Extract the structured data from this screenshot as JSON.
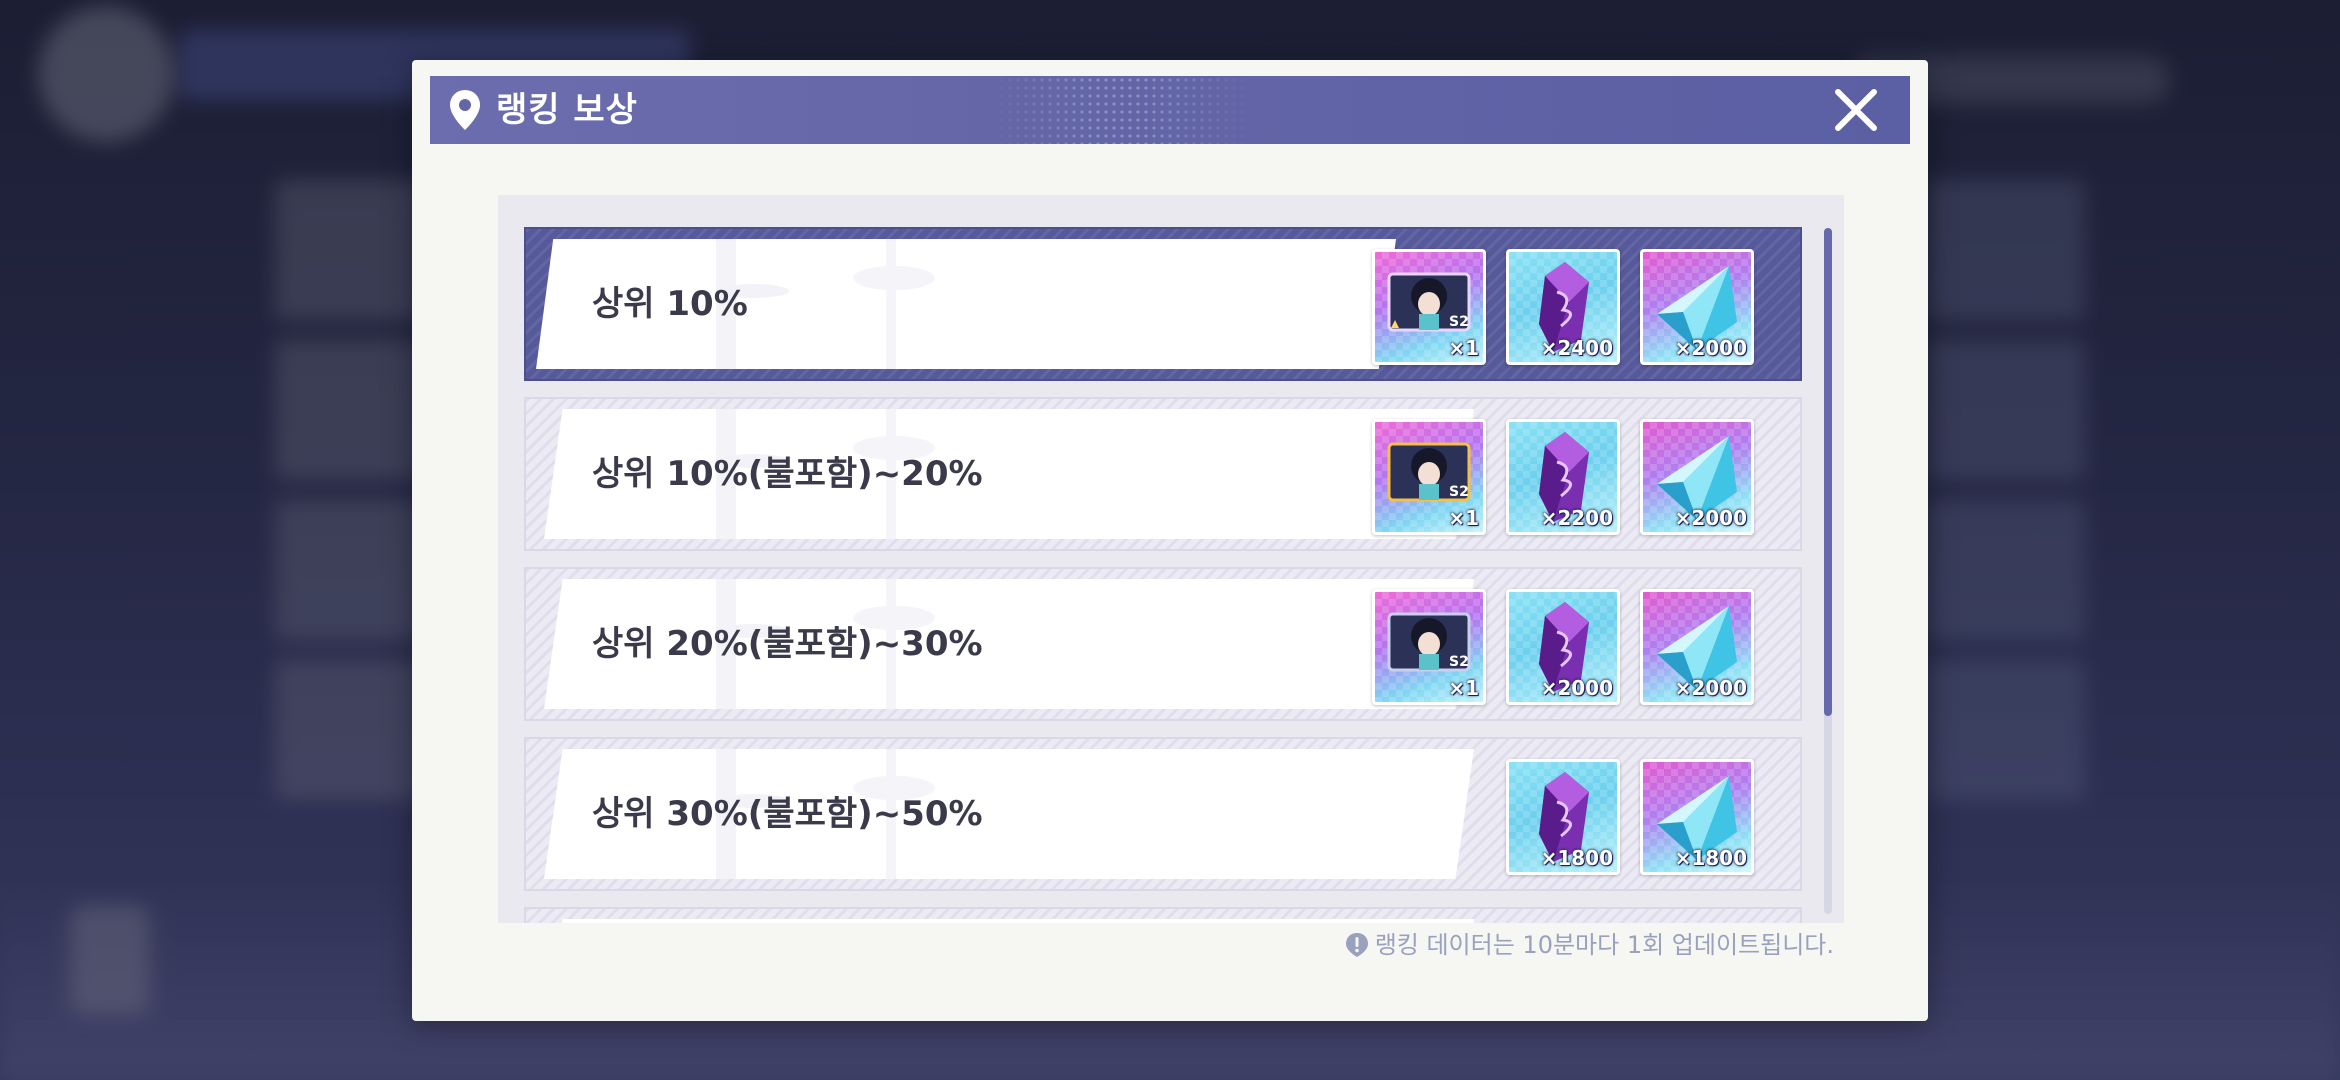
{
  "modal": {
    "title": "랭킹 보상",
    "footer_note": "랭킹 데이터는 10분마다 1회 업데이트됩니다."
  },
  "rewards": [
    {
      "rank": "상위 10%",
      "active": true,
      "items": [
        {
          "type": "character-card",
          "badge": "S2",
          "qty": "×1"
        },
        {
          "type": "purple-crystal",
          "qty": "×2400"
        },
        {
          "type": "blue-gem",
          "qty": "×2000"
        }
      ]
    },
    {
      "rank": "상위 10%(불포함)~20%",
      "items": [
        {
          "type": "character-card",
          "badge": "S2",
          "qty": "×1"
        },
        {
          "type": "purple-crystal",
          "qty": "×2200"
        },
        {
          "type": "blue-gem",
          "qty": "×2000"
        }
      ]
    },
    {
      "rank": "상위 20%(불포함)~30%",
      "items": [
        {
          "type": "character-card",
          "badge": "S2",
          "qty": "×1"
        },
        {
          "type": "purple-crystal",
          "qty": "×2000"
        },
        {
          "type": "blue-gem",
          "qty": "×2000"
        }
      ]
    },
    {
      "rank": "상위 30%(불포함)~50%",
      "items": [
        {
          "type": "purple-crystal",
          "qty": "×1800"
        },
        {
          "type": "blue-gem",
          "qty": "×1800"
        }
      ]
    }
  ],
  "colors": {
    "header": "#6466a8",
    "active_row": "#56599a",
    "scroll_thumb": "#6669ac",
    "note_text": "#9aa1bf"
  },
  "icons": [
    "map-pin-icon",
    "close-icon",
    "info-icon"
  ]
}
